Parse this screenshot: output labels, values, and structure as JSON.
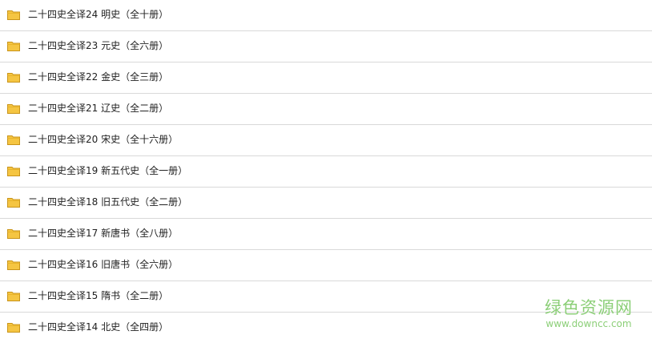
{
  "folders": [
    {
      "label": "二十四史全译24 明史（全十册）"
    },
    {
      "label": "二十四史全译23 元史（全六册）"
    },
    {
      "label": "二十四史全译22 金史（全三册）"
    },
    {
      "label": "二十四史全译21 辽史（全二册）"
    },
    {
      "label": "二十四史全译20 宋史（全十六册）"
    },
    {
      "label": "二十四史全译19 新五代史（全一册）"
    },
    {
      "label": "二十四史全译18 旧五代史（全二册）"
    },
    {
      "label": "二十四史全译17 新唐书（全八册）"
    },
    {
      "label": "二十四史全译16 旧唐书（全六册）"
    },
    {
      "label": "二十四史全译15 隋书（全二册）"
    },
    {
      "label": "二十四史全译14 北史（全四册）"
    }
  ],
  "icon": "folder-icon",
  "colors": {
    "folder_fill": "#f5c542",
    "folder_edge": "#c9941a",
    "divider": "#d9d9d9",
    "watermark": "#8ccf78"
  },
  "watermark": {
    "cn": "绿色资源网",
    "url": "www.downcc.com"
  }
}
